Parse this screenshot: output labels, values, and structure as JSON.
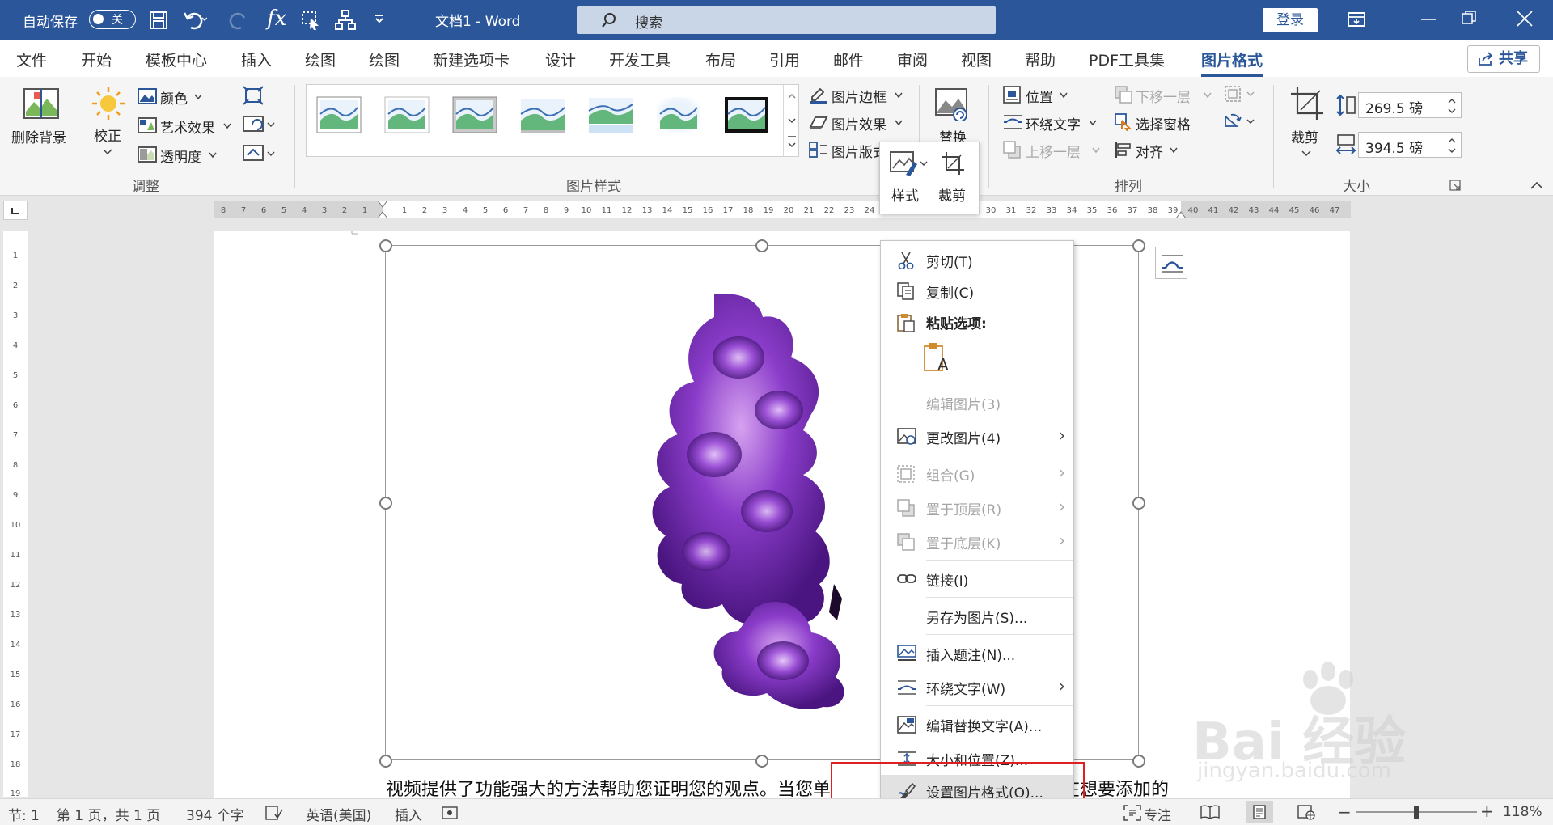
{
  "titlebar": {
    "autosave_label": "自动保存",
    "autosave_state": "关",
    "doc_title": "文档1  -  Word",
    "search_placeholder": "搜索",
    "login_label": "登录"
  },
  "tabs": [
    {
      "label": "文件"
    },
    {
      "label": "开始"
    },
    {
      "label": "模板中心"
    },
    {
      "label": "插入"
    },
    {
      "label": "绘图"
    },
    {
      "label": "绘图"
    },
    {
      "label": "新建选项卡"
    },
    {
      "label": "设计"
    },
    {
      "label": "开发工具"
    },
    {
      "label": "布局"
    },
    {
      "label": "引用"
    },
    {
      "label": "邮件"
    },
    {
      "label": "审阅"
    },
    {
      "label": "视图"
    },
    {
      "label": "帮助"
    },
    {
      "label": "PDF工具集"
    },
    {
      "label": "图片格式"
    }
  ],
  "share_label": "共享",
  "ribbon": {
    "remove_bg": "删除背景",
    "correct": "校正",
    "color": "颜色",
    "art_effect": "艺术效果",
    "transparency": "透明度",
    "group_adjust": "调整",
    "group_styles": "图片样式",
    "pic_border": "图片边框",
    "pic_effect": "图片效果",
    "pic_layout": "图片版式",
    "replace": "替换",
    "position": "位置",
    "wrap_text": "环绕文字",
    "bring_forward": "上移一层",
    "send_backward": "下移一层",
    "selection_pane": "选择窗格",
    "align": "对齐",
    "group_arrange": "排列",
    "crop": "裁剪",
    "height": "269.5 磅",
    "width": "394.5 磅",
    "group_size": "大小"
  },
  "mini_toolbar": {
    "style": "样式",
    "crop": "裁剪"
  },
  "context_menu": {
    "cut": "剪切(T)",
    "copy": "复制(C)",
    "paste_options": "粘贴选项:",
    "edit_picture": "编辑图片(3)",
    "change_picture": "更改图片(4)",
    "group": "组合(G)",
    "bring_front": "置于顶层(R)",
    "send_back": "置于底层(K)",
    "link": "链接(I)",
    "save_as_picture": "另存为图片(S)...",
    "insert_caption": "插入题注(N)...",
    "wrap_text": "环绕文字(W)",
    "edit_alt_text": "编辑替换文字(A)...",
    "size_position": "大小和位置(Z)...",
    "format_picture": "设置图片格式(O)..."
  },
  "document": {
    "body_text_left": "视频提供了功能强大的方法帮助您证明您的观点。当您单",
    "body_text_right": "在想要添加的"
  },
  "status": {
    "section": "节: 1",
    "page": "第 1 页，共 1 页",
    "words": "394 个字",
    "language": "英语(美国)",
    "insert_mode": "插入",
    "focus": "专注",
    "zoom": "118%"
  },
  "watermark": {
    "brand": "Bai 经验",
    "url": "jingyan.baidu.com"
  },
  "colors": {
    "brand": "#2b579a",
    "highlight": "#e02020"
  }
}
